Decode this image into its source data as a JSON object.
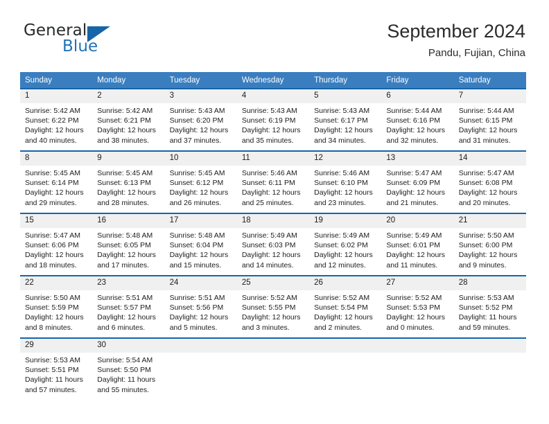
{
  "logo": {
    "word1": "General",
    "word2": "Blue",
    "triangle_color": "#1565a8",
    "blue_color": "#1f72b8"
  },
  "header": {
    "title": "September 2024",
    "subtitle": "Pandu, Fujian, China"
  },
  "theme": {
    "header_blue": "#3a7ebf",
    "row_border_blue": "#1565a8",
    "daynum_bg": "#f0f0f0"
  },
  "weekday_headers": [
    "Sunday",
    "Monday",
    "Tuesday",
    "Wednesday",
    "Thursday",
    "Friday",
    "Saturday"
  ],
  "labels": {
    "sunrise": "Sunrise:",
    "sunset": "Sunset:",
    "daylight": "Daylight:"
  },
  "weeks": [
    [
      {
        "day": "1",
        "sunrise": "Sunrise: 5:42 AM",
        "sunset": "Sunset: 6:22 PM",
        "daylight": "Daylight: 12 hours and 40 minutes."
      },
      {
        "day": "2",
        "sunrise": "Sunrise: 5:42 AM",
        "sunset": "Sunset: 6:21 PM",
        "daylight": "Daylight: 12 hours and 38 minutes."
      },
      {
        "day": "3",
        "sunrise": "Sunrise: 5:43 AM",
        "sunset": "Sunset: 6:20 PM",
        "daylight": "Daylight: 12 hours and 37 minutes."
      },
      {
        "day": "4",
        "sunrise": "Sunrise: 5:43 AM",
        "sunset": "Sunset: 6:19 PM",
        "daylight": "Daylight: 12 hours and 35 minutes."
      },
      {
        "day": "5",
        "sunrise": "Sunrise: 5:43 AM",
        "sunset": "Sunset: 6:17 PM",
        "daylight": "Daylight: 12 hours and 34 minutes."
      },
      {
        "day": "6",
        "sunrise": "Sunrise: 5:44 AM",
        "sunset": "Sunset: 6:16 PM",
        "daylight": "Daylight: 12 hours and 32 minutes."
      },
      {
        "day": "7",
        "sunrise": "Sunrise: 5:44 AM",
        "sunset": "Sunset: 6:15 PM",
        "daylight": "Daylight: 12 hours and 31 minutes."
      }
    ],
    [
      {
        "day": "8",
        "sunrise": "Sunrise: 5:45 AM",
        "sunset": "Sunset: 6:14 PM",
        "daylight": "Daylight: 12 hours and 29 minutes."
      },
      {
        "day": "9",
        "sunrise": "Sunrise: 5:45 AM",
        "sunset": "Sunset: 6:13 PM",
        "daylight": "Daylight: 12 hours and 28 minutes."
      },
      {
        "day": "10",
        "sunrise": "Sunrise: 5:45 AM",
        "sunset": "Sunset: 6:12 PM",
        "daylight": "Daylight: 12 hours and 26 minutes."
      },
      {
        "day": "11",
        "sunrise": "Sunrise: 5:46 AM",
        "sunset": "Sunset: 6:11 PM",
        "daylight": "Daylight: 12 hours and 25 minutes."
      },
      {
        "day": "12",
        "sunrise": "Sunrise: 5:46 AM",
        "sunset": "Sunset: 6:10 PM",
        "daylight": "Daylight: 12 hours and 23 minutes."
      },
      {
        "day": "13",
        "sunrise": "Sunrise: 5:47 AM",
        "sunset": "Sunset: 6:09 PM",
        "daylight": "Daylight: 12 hours and 21 minutes."
      },
      {
        "day": "14",
        "sunrise": "Sunrise: 5:47 AM",
        "sunset": "Sunset: 6:08 PM",
        "daylight": "Daylight: 12 hours and 20 minutes."
      }
    ],
    [
      {
        "day": "15",
        "sunrise": "Sunrise: 5:47 AM",
        "sunset": "Sunset: 6:06 PM",
        "daylight": "Daylight: 12 hours and 18 minutes."
      },
      {
        "day": "16",
        "sunrise": "Sunrise: 5:48 AM",
        "sunset": "Sunset: 6:05 PM",
        "daylight": "Daylight: 12 hours and 17 minutes."
      },
      {
        "day": "17",
        "sunrise": "Sunrise: 5:48 AM",
        "sunset": "Sunset: 6:04 PM",
        "daylight": "Daylight: 12 hours and 15 minutes."
      },
      {
        "day": "18",
        "sunrise": "Sunrise: 5:49 AM",
        "sunset": "Sunset: 6:03 PM",
        "daylight": "Daylight: 12 hours and 14 minutes."
      },
      {
        "day": "19",
        "sunrise": "Sunrise: 5:49 AM",
        "sunset": "Sunset: 6:02 PM",
        "daylight": "Daylight: 12 hours and 12 minutes."
      },
      {
        "day": "20",
        "sunrise": "Sunrise: 5:49 AM",
        "sunset": "Sunset: 6:01 PM",
        "daylight": "Daylight: 12 hours and 11 minutes."
      },
      {
        "day": "21",
        "sunrise": "Sunrise: 5:50 AM",
        "sunset": "Sunset: 6:00 PM",
        "daylight": "Daylight: 12 hours and 9 minutes."
      }
    ],
    [
      {
        "day": "22",
        "sunrise": "Sunrise: 5:50 AM",
        "sunset": "Sunset: 5:59 PM",
        "daylight": "Daylight: 12 hours and 8 minutes."
      },
      {
        "day": "23",
        "sunrise": "Sunrise: 5:51 AM",
        "sunset": "Sunset: 5:57 PM",
        "daylight": "Daylight: 12 hours and 6 minutes."
      },
      {
        "day": "24",
        "sunrise": "Sunrise: 5:51 AM",
        "sunset": "Sunset: 5:56 PM",
        "daylight": "Daylight: 12 hours and 5 minutes."
      },
      {
        "day": "25",
        "sunrise": "Sunrise: 5:52 AM",
        "sunset": "Sunset: 5:55 PM",
        "daylight": "Daylight: 12 hours and 3 minutes."
      },
      {
        "day": "26",
        "sunrise": "Sunrise: 5:52 AM",
        "sunset": "Sunset: 5:54 PM",
        "daylight": "Daylight: 12 hours and 2 minutes."
      },
      {
        "day": "27",
        "sunrise": "Sunrise: 5:52 AM",
        "sunset": "Sunset: 5:53 PM",
        "daylight": "Daylight: 12 hours and 0 minutes."
      },
      {
        "day": "28",
        "sunrise": "Sunrise: 5:53 AM",
        "sunset": "Sunset: 5:52 PM",
        "daylight": "Daylight: 11 hours and 59 minutes."
      }
    ],
    [
      {
        "day": "29",
        "sunrise": "Sunrise: 5:53 AM",
        "sunset": "Sunset: 5:51 PM",
        "daylight": "Daylight: 11 hours and 57 minutes."
      },
      {
        "day": "30",
        "sunrise": "Sunrise: 5:54 AM",
        "sunset": "Sunset: 5:50 PM",
        "daylight": "Daylight: 11 hours and 55 minutes."
      },
      {
        "day": "",
        "sunrise": "",
        "sunset": "",
        "daylight": ""
      },
      {
        "day": "",
        "sunrise": "",
        "sunset": "",
        "daylight": ""
      },
      {
        "day": "",
        "sunrise": "",
        "sunset": "",
        "daylight": ""
      },
      {
        "day": "",
        "sunrise": "",
        "sunset": "",
        "daylight": ""
      },
      {
        "day": "",
        "sunrise": "",
        "sunset": "",
        "daylight": ""
      }
    ]
  ]
}
